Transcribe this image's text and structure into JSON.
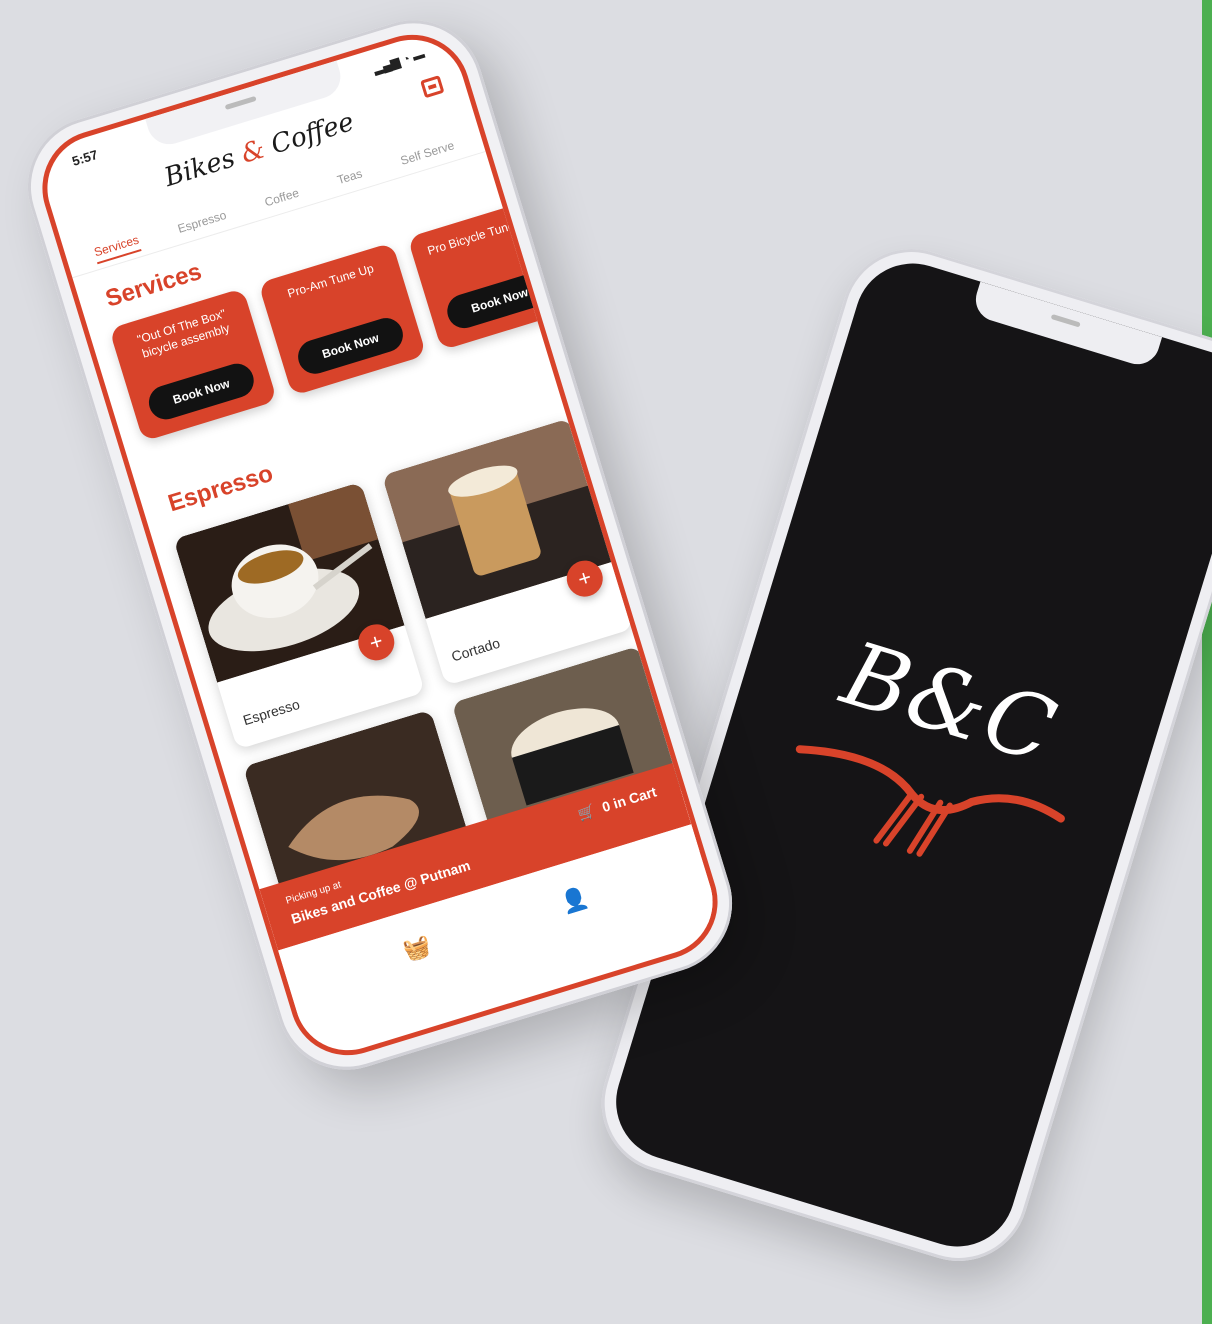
{
  "colors": {
    "accent": "#d8432a",
    "dark": "#121212",
    "splash_bg": "#151416"
  },
  "status_bar": {
    "time": "5:57",
    "icons": "▂▄▆ ◔ ▬"
  },
  "header": {
    "logo_part1": "Bikes ",
    "logo_amp": "&",
    "logo_part2": " Coffee",
    "icon": "receipt-icon"
  },
  "tabs": [
    {
      "label": "Services",
      "active": true
    },
    {
      "label": "Espresso"
    },
    {
      "label": "Coffee"
    },
    {
      "label": "Teas"
    },
    {
      "label": "Self Serve"
    }
  ],
  "services": {
    "title": "Services",
    "cards": [
      {
        "title": "\"Out Of The Box\" bicycle assembly",
        "button": "Book Now"
      },
      {
        "title": "Pro-Am Tune Up",
        "button": "Book Now"
      },
      {
        "title": "Pro Bicycle Tune Up",
        "button": "Book Now"
      }
    ]
  },
  "espresso": {
    "title": "Espresso",
    "products": [
      {
        "name": "Espresso",
        "add": "+"
      },
      {
        "name": "Cortado",
        "add": "+"
      },
      {
        "name": "",
        "add": ""
      },
      {
        "name": "",
        "add": ""
      }
    ]
  },
  "cart_bar": {
    "pickup_label": "Picking up at",
    "location": "Bikes and Coffee @ Putnam",
    "cart_text": "0 in Cart",
    "cart_icon": "cart-icon"
  },
  "bottom_nav": {
    "items": [
      {
        "icon": "basket-icon",
        "glyph": "🧺"
      },
      {
        "icon": "profile-icon",
        "glyph": "👤"
      }
    ]
  },
  "splash": {
    "logo": "B&C"
  }
}
